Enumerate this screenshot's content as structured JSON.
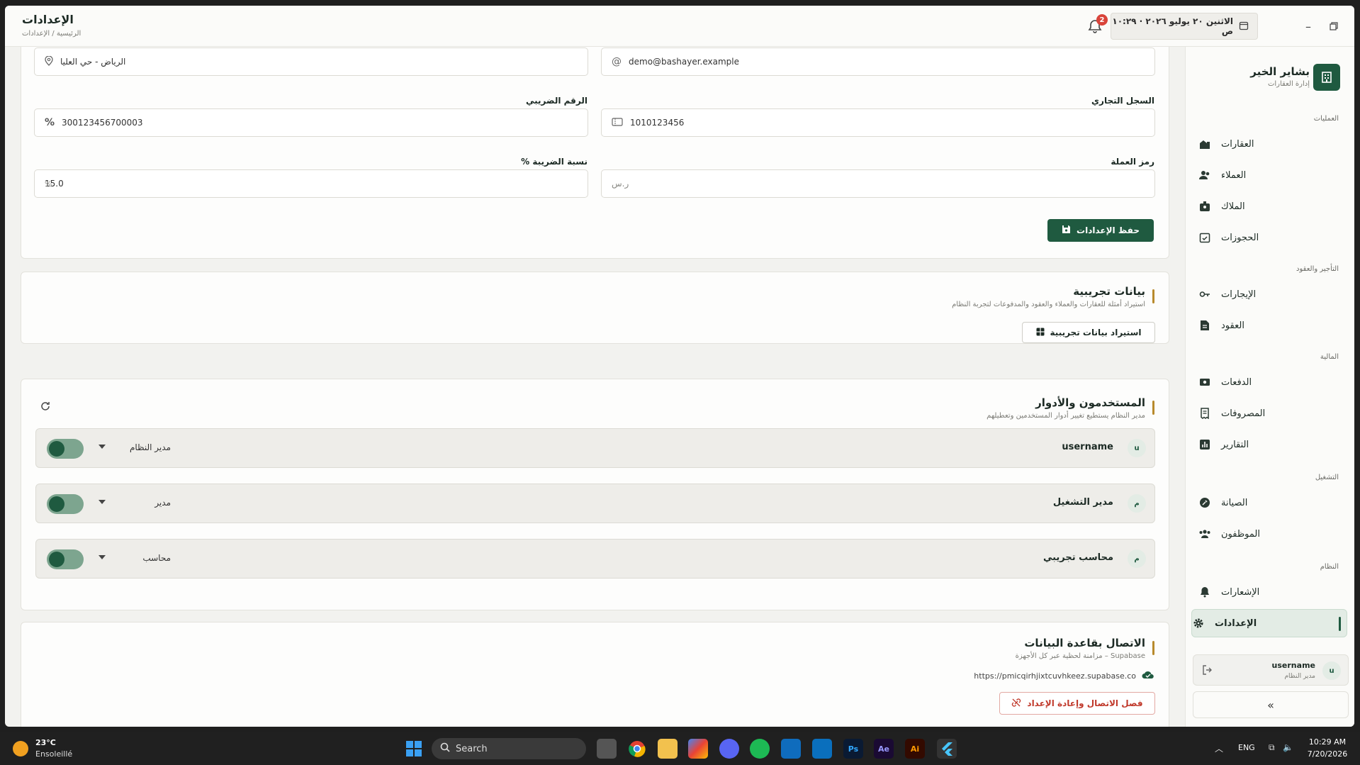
{
  "header": {
    "title": "الإعدادات",
    "breadcrumb": "الرئيسية / الإعدادات",
    "datetime": "الاثنين ٢٠ يوليو ٢٠٢٦ · ١٠:٢٩ ص",
    "notification_count": "2"
  },
  "sidebar": {
    "brand_name": "بشاير الخير",
    "brand_sub": "إدارة العقارات",
    "sections": {
      "ops": "العمليات",
      "rent": "التأجير والعقود",
      "finance": "المالية",
      "operation": "التشغيل",
      "system": "النظام"
    },
    "items": {
      "properties": "العقارات",
      "clients": "العملاء",
      "owners": "الملاك",
      "bookings": "الحجوزات",
      "leases": "الإيجارات",
      "contracts": "العقود",
      "payments": "الدفعات",
      "expenses": "المصروفات",
      "reports": "التقارير",
      "maintenance": "الصيانة",
      "employees": "الموظفون",
      "notifications": "الإشعارات",
      "settings": "الإعدادات"
    },
    "user": {
      "name": "username",
      "role": "مدير النظام",
      "initial": "u"
    },
    "collapse_label": "«"
  },
  "company_form": {
    "email": "demo@bashayer.example",
    "address": "الرياض - حي العليا",
    "cr_label": "السجل التجاري",
    "cr_value": "1010123456",
    "tax_label": "الرقم الضريبي",
    "tax_value": "300123456700003",
    "currency_label": "رمز العملة",
    "currency_placeholder": "ر.س",
    "vat_label": "نسبة الضريبة %",
    "vat_value": "15.0",
    "vat_suffix": "%",
    "save_label": "حفظ الإعدادات"
  },
  "demo": {
    "title": "بيانات تجريبية",
    "subtitle": "استيراد أمثلة للعقارات والعملاء والعقود والمدفوعات لتجربة النظام",
    "import_label": "استيراد بيانات تجريبية"
  },
  "users": {
    "title": "المستخدمون والأدوار",
    "subtitle": "مدير النظام يستطيع تغيير أدوار المستخدمين وتعطيلهم",
    "rows": [
      {
        "initial": "u",
        "name": "username",
        "role": "مدير النظام"
      },
      {
        "initial": "م",
        "name": "مدير التشغيل",
        "role": "مدير"
      },
      {
        "initial": "م",
        "name": "محاسب تجريبي",
        "role": "محاسب"
      }
    ]
  },
  "db": {
    "title": "الاتصال بقاعدة البيانات",
    "subtitle": "Supabase – مزامنة لحظية عبر كل الأجهزة",
    "url": "https://pmicqirhjixtcuvhkeez.supabase.co",
    "disconnect_label": "فصل الاتصال وإعادة الإعداد"
  },
  "taskbar": {
    "weather_temp": "23°C",
    "weather_desc": "Ensoleillé",
    "search": "Search",
    "lang": "ENG",
    "time": "10:29 AM",
    "date": "7/20/2026",
    "apps": [
      "Ps",
      "Ae",
      "Ai"
    ]
  },
  "colors": {
    "primary": "#1f5a40",
    "accent": "#b88a2c",
    "danger": "#d9443b"
  }
}
